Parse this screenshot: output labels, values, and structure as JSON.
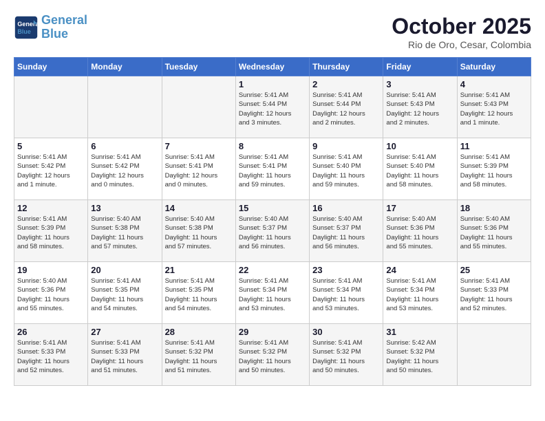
{
  "header": {
    "logo_line1": "General",
    "logo_line2": "Blue",
    "month": "October 2025",
    "location": "Rio de Oro, Cesar, Colombia"
  },
  "weekdays": [
    "Sunday",
    "Monday",
    "Tuesday",
    "Wednesday",
    "Thursday",
    "Friday",
    "Saturday"
  ],
  "weeks": [
    [
      {
        "day": "",
        "info": ""
      },
      {
        "day": "",
        "info": ""
      },
      {
        "day": "",
        "info": ""
      },
      {
        "day": "1",
        "info": "Sunrise: 5:41 AM\nSunset: 5:44 PM\nDaylight: 12 hours\nand 3 minutes."
      },
      {
        "day": "2",
        "info": "Sunrise: 5:41 AM\nSunset: 5:44 PM\nDaylight: 12 hours\nand 2 minutes."
      },
      {
        "day": "3",
        "info": "Sunrise: 5:41 AM\nSunset: 5:43 PM\nDaylight: 12 hours\nand 2 minutes."
      },
      {
        "day": "4",
        "info": "Sunrise: 5:41 AM\nSunset: 5:43 PM\nDaylight: 12 hours\nand 1 minute."
      }
    ],
    [
      {
        "day": "5",
        "info": "Sunrise: 5:41 AM\nSunset: 5:42 PM\nDaylight: 12 hours\nand 1 minute."
      },
      {
        "day": "6",
        "info": "Sunrise: 5:41 AM\nSunset: 5:42 PM\nDaylight: 12 hours\nand 0 minutes."
      },
      {
        "day": "7",
        "info": "Sunrise: 5:41 AM\nSunset: 5:41 PM\nDaylight: 12 hours\nand 0 minutes."
      },
      {
        "day": "8",
        "info": "Sunrise: 5:41 AM\nSunset: 5:41 PM\nDaylight: 11 hours\nand 59 minutes."
      },
      {
        "day": "9",
        "info": "Sunrise: 5:41 AM\nSunset: 5:40 PM\nDaylight: 11 hours\nand 59 minutes."
      },
      {
        "day": "10",
        "info": "Sunrise: 5:41 AM\nSunset: 5:40 PM\nDaylight: 11 hours\nand 58 minutes."
      },
      {
        "day": "11",
        "info": "Sunrise: 5:41 AM\nSunset: 5:39 PM\nDaylight: 11 hours\nand 58 minutes."
      }
    ],
    [
      {
        "day": "12",
        "info": "Sunrise: 5:41 AM\nSunset: 5:39 PM\nDaylight: 11 hours\nand 58 minutes."
      },
      {
        "day": "13",
        "info": "Sunrise: 5:40 AM\nSunset: 5:38 PM\nDaylight: 11 hours\nand 57 minutes."
      },
      {
        "day": "14",
        "info": "Sunrise: 5:40 AM\nSunset: 5:38 PM\nDaylight: 11 hours\nand 57 minutes."
      },
      {
        "day": "15",
        "info": "Sunrise: 5:40 AM\nSunset: 5:37 PM\nDaylight: 11 hours\nand 56 minutes."
      },
      {
        "day": "16",
        "info": "Sunrise: 5:40 AM\nSunset: 5:37 PM\nDaylight: 11 hours\nand 56 minutes."
      },
      {
        "day": "17",
        "info": "Sunrise: 5:40 AM\nSunset: 5:36 PM\nDaylight: 11 hours\nand 55 minutes."
      },
      {
        "day": "18",
        "info": "Sunrise: 5:40 AM\nSunset: 5:36 PM\nDaylight: 11 hours\nand 55 minutes."
      }
    ],
    [
      {
        "day": "19",
        "info": "Sunrise: 5:40 AM\nSunset: 5:36 PM\nDaylight: 11 hours\nand 55 minutes."
      },
      {
        "day": "20",
        "info": "Sunrise: 5:41 AM\nSunset: 5:35 PM\nDaylight: 11 hours\nand 54 minutes."
      },
      {
        "day": "21",
        "info": "Sunrise: 5:41 AM\nSunset: 5:35 PM\nDaylight: 11 hours\nand 54 minutes."
      },
      {
        "day": "22",
        "info": "Sunrise: 5:41 AM\nSunset: 5:34 PM\nDaylight: 11 hours\nand 53 minutes."
      },
      {
        "day": "23",
        "info": "Sunrise: 5:41 AM\nSunset: 5:34 PM\nDaylight: 11 hours\nand 53 minutes."
      },
      {
        "day": "24",
        "info": "Sunrise: 5:41 AM\nSunset: 5:34 PM\nDaylight: 11 hours\nand 53 minutes."
      },
      {
        "day": "25",
        "info": "Sunrise: 5:41 AM\nSunset: 5:33 PM\nDaylight: 11 hours\nand 52 minutes."
      }
    ],
    [
      {
        "day": "26",
        "info": "Sunrise: 5:41 AM\nSunset: 5:33 PM\nDaylight: 11 hours\nand 52 minutes."
      },
      {
        "day": "27",
        "info": "Sunrise: 5:41 AM\nSunset: 5:33 PM\nDaylight: 11 hours\nand 51 minutes."
      },
      {
        "day": "28",
        "info": "Sunrise: 5:41 AM\nSunset: 5:32 PM\nDaylight: 11 hours\nand 51 minutes."
      },
      {
        "day": "29",
        "info": "Sunrise: 5:41 AM\nSunset: 5:32 PM\nDaylight: 11 hours\nand 50 minutes."
      },
      {
        "day": "30",
        "info": "Sunrise: 5:41 AM\nSunset: 5:32 PM\nDaylight: 11 hours\nand 50 minutes."
      },
      {
        "day": "31",
        "info": "Sunrise: 5:42 AM\nSunset: 5:32 PM\nDaylight: 11 hours\nand 50 minutes."
      },
      {
        "day": "",
        "info": ""
      }
    ]
  ]
}
